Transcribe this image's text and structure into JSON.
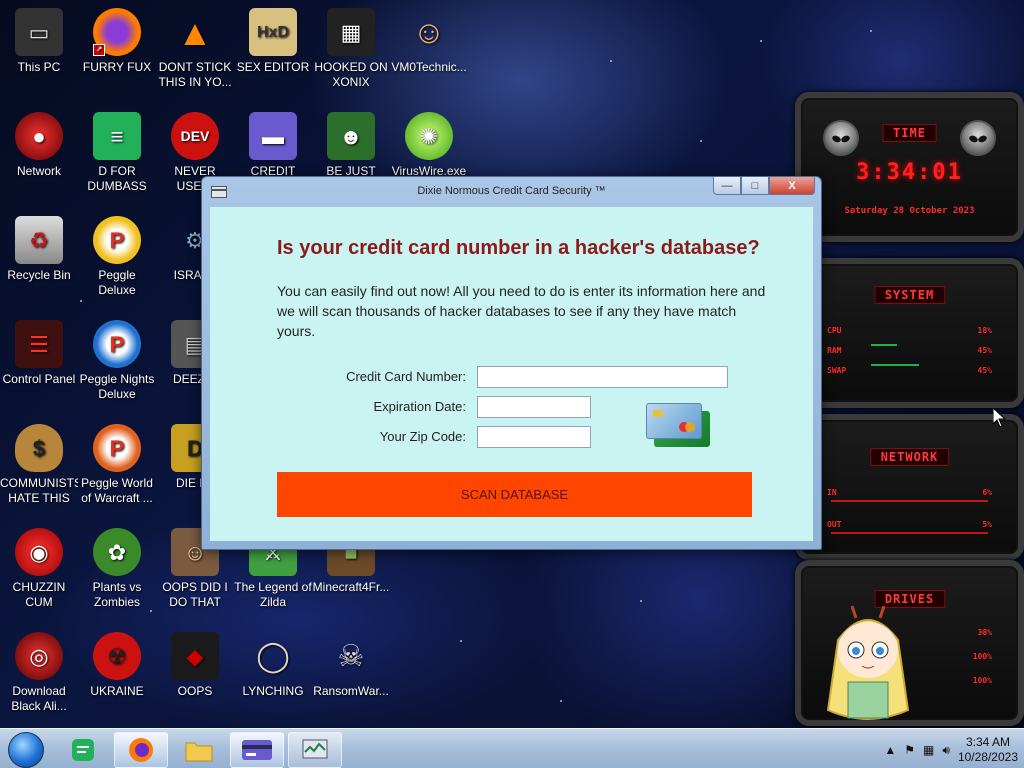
{
  "desktop": {
    "icons": [
      {
        "label": "This PC",
        "icon": "computer-icon",
        "color": "#333333"
      },
      {
        "label": "FURRY FUX",
        "icon": "firefox-icon",
        "color": "#ff7a00"
      },
      {
        "label": "DONT STICK THIS IN YO...",
        "icon": "vlc-cone-icon",
        "color": "#ff8800"
      },
      {
        "label": "SEX EDITOR",
        "icon": "hxd-editor-icon",
        "color": "#d8c080"
      },
      {
        "label": "HOOKED ON XONIX",
        "icon": "xonix-game-icon",
        "color": "#222222"
      },
      {
        "label": "VM0Technic...",
        "icon": "doctor-icon",
        "color": "#f0b070"
      },
      {
        "label": "Network",
        "icon": "network-icon",
        "color": "#b01010"
      },
      {
        "label": "D FOR DUMBASS",
        "icon": "document-icon",
        "color": "#22b05a"
      },
      {
        "label": "NEVER USED!",
        "icon": "dev-cpp-icon",
        "color": "#cc1111"
      },
      {
        "label": "CREDIT CARD",
        "icon": "credit-card-icon",
        "color": "#6a5acd"
      },
      {
        "label": "BE JUST LIKE",
        "icon": "elf-icon",
        "color": "#2c6e2c"
      },
      {
        "label": "VirusWire.exe",
        "icon": "limewire-icon",
        "color": "#6cd13a"
      },
      {
        "label": "Recycle Bin",
        "icon": "recycle-bin-icon",
        "color": "#c01818"
      },
      {
        "label": "Peggle Deluxe",
        "icon": "peggle-icon",
        "color": "#e0301e"
      },
      {
        "label": "ISRAEL",
        "icon": "program-icon",
        "color": "#8aa8c8"
      },
      {
        "label": "Control Panel",
        "icon": "control-panel-icon",
        "color": "#c01818"
      },
      {
        "label": "Peggle Nights Deluxe",
        "icon": "peggle-nights-icon",
        "color": "#2070d0"
      },
      {
        "label": "DEEZ N",
        "icon": "windows-stack-icon",
        "color": "#555555"
      },
      {
        "label": "COMMUNISTS HATE THIS G...",
        "icon": "money-bag-icon",
        "color": "#b8863b"
      },
      {
        "label": "Peggle World of Warcraft ...",
        "icon": "peggle-wow-icon",
        "color": "#e0601e"
      },
      {
        "label": "DIE PL",
        "icon": "dp-icon",
        "color": "#c8a020"
      },
      {
        "label": "CHUZZIN CUM",
        "icon": "chuzzle-icon",
        "color": "#cc1a1a"
      },
      {
        "label": "Plants vs Zombies",
        "icon": "plants-vs-zombies-icon",
        "color": "#3a8a2a"
      },
      {
        "label": "OOPS DID I DO THAT",
        "icon": "portrait-icon",
        "color": "#7a5a40"
      },
      {
        "label": "The Legend of Zilda",
        "icon": "zelda-icon",
        "color": "#40a040"
      },
      {
        "label": "Minecraft4Fr...",
        "icon": "minecraft-icon",
        "color": "#6b4a2a"
      },
      {
        "label": "Download Black Ali...",
        "icon": "alien-skin-icon",
        "color": "#b01010"
      },
      {
        "label": "UKRAINE",
        "icon": "radiation-icon",
        "color": "#cc1111"
      },
      {
        "label": "OOPS",
        "icon": "oops-icon",
        "color": "#1a1a1a"
      },
      {
        "label": "LYNCHING",
        "icon": "noose-icon",
        "color": "#e0d6c0"
      },
      {
        "label": "RansomWar...",
        "icon": "skull-icon",
        "color": "#9a9a9a"
      }
    ]
  },
  "gadgets": {
    "time": {
      "header": "TIME",
      "digits": "3:34:01",
      "date": "Saturday 28 October 2023"
    },
    "system": {
      "header": "SYSTEM",
      "rows": [
        {
          "label": "CPU",
          "value": "18%"
        },
        {
          "label": "RAM",
          "value": "45%"
        },
        {
          "label": "SWAP",
          "value": "45%"
        }
      ]
    },
    "network": {
      "header": "NETWORK",
      "rows": [
        {
          "label": "IN",
          "value": "6%"
        },
        {
          "label": "OUT",
          "value": "5%"
        }
      ]
    },
    "drives": {
      "header": "DRIVES",
      "rows": [
        {
          "value": "38%"
        },
        {
          "value": "100%"
        },
        {
          "value": "100%"
        }
      ]
    }
  },
  "dialog": {
    "title": "Dixie Normous Credit Card Security ™",
    "headline": "Is your credit card number in a hacker's database?",
    "intro": "You can easily find out now! All you need to do is enter its information here and we will scan thousands of hacker databases to see if any they have match yours.",
    "fields": {
      "card_number_label": "Credit Card Number:",
      "card_number_value": "",
      "expiration_label": "Expiration Date:",
      "expiration_value": "",
      "zip_label": "Your Zip Code:",
      "zip_value": ""
    },
    "scan_button": "SCAN DATABASE",
    "controls": {
      "minimize": "—",
      "maximize": "□",
      "close": "X"
    },
    "colors": {
      "client_bg": "#c9f4f1",
      "headline": "#8b1a1a",
      "button": "#ff4500"
    }
  },
  "taskbar": {
    "items": [
      {
        "name": "docs-app",
        "icon": "document-icon"
      },
      {
        "name": "firefox",
        "icon": "firefox-icon"
      },
      {
        "name": "file-explorer",
        "icon": "folder-icon"
      },
      {
        "name": "credit-card-app",
        "icon": "credit-card-icon"
      },
      {
        "name": "task-manager",
        "icon": "task-manager-icon"
      }
    ],
    "clock": {
      "time": "3:34 AM",
      "date": "10/28/2023"
    }
  }
}
